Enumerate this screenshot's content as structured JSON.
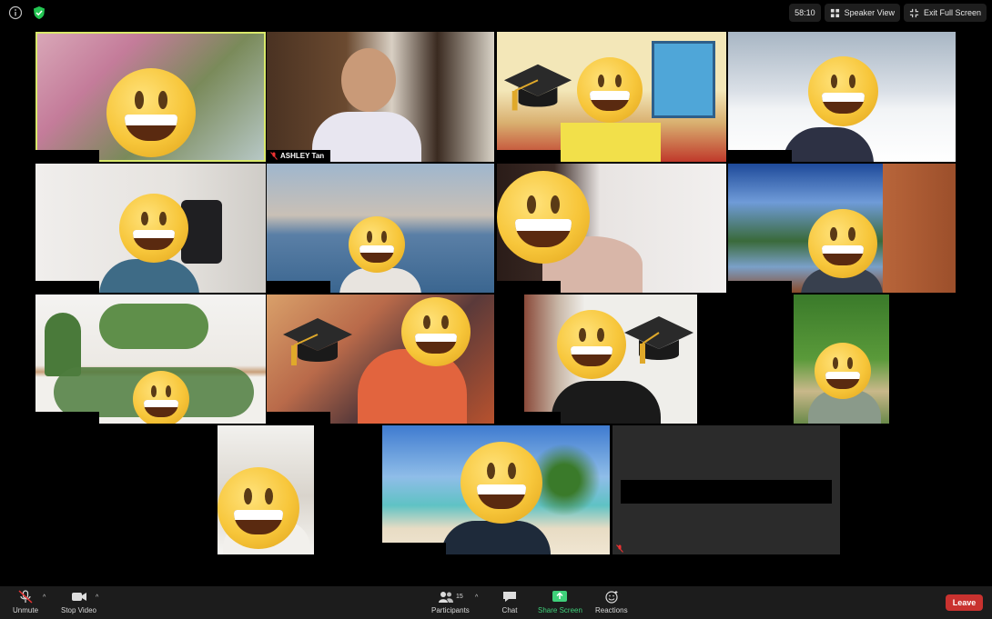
{
  "topbar": {
    "timer": "58:10",
    "speaker_view_label": "Speaker View",
    "exit_full_screen_label": "Exit Full Screen",
    "icons": [
      "info-icon",
      "shield-check-icon",
      "grid-icon",
      "exit-fullscreen-icon"
    ]
  },
  "participants": [
    {
      "id": "p1",
      "name": "",
      "active": true
    },
    {
      "id": "p2",
      "name": "ASHLEY Tan",
      "muted": true
    },
    {
      "id": "p3",
      "name": ""
    },
    {
      "id": "p4",
      "name": ""
    },
    {
      "id": "p5",
      "name": ""
    },
    {
      "id": "p6",
      "name": ""
    },
    {
      "id": "p7",
      "name": ""
    },
    {
      "id": "p8",
      "name": ""
    },
    {
      "id": "p9",
      "name": ""
    },
    {
      "id": "p10",
      "name": ""
    },
    {
      "id": "p11",
      "name": ""
    },
    {
      "id": "p12",
      "name": ""
    },
    {
      "id": "p13",
      "name": ""
    },
    {
      "id": "p14",
      "name": ""
    },
    {
      "id": "p15",
      "name": "",
      "muted": true
    }
  ],
  "toolbar": {
    "unmute_label": "Unmute",
    "stop_video_label": "Stop Video",
    "participants_label": "Participants",
    "participants_count": "15",
    "chat_label": "Chat",
    "share_screen_label": "Share Screen",
    "reactions_label": "Reactions",
    "leave_label": "Leave",
    "colors": {
      "share": "#3fd07a",
      "leave": "#c9322f",
      "active_border": "#d9e86b"
    }
  }
}
